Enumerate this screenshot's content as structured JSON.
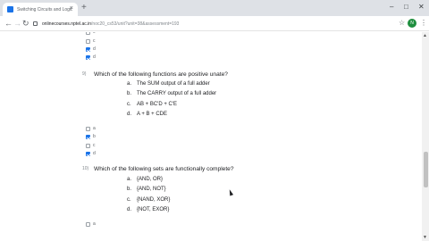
{
  "browser": {
    "tab_title": "Switching Circuits and Logic Des",
    "tab_close": "×",
    "new_tab": "+",
    "url_domain": "onlinecourses.nptel.ac.in",
    "url_rest": "/noc20_cs53/unit?unit=38&assessment=193",
    "avatar_initial": "N",
    "window_controls": {
      "minimize": "–",
      "maximize": "□",
      "close": "✕"
    }
  },
  "questions": [
    {
      "number": "9)",
      "text": "Which of the following functions are positive unate?",
      "choices": [
        {
          "label": "a.",
          "text": "The SUM output of a full adder"
        },
        {
          "label": "b.",
          "text": "The CARRY output of a full adder"
        },
        {
          "label": "c.",
          "text": "AB + BC'D + C'E"
        },
        {
          "label": "d.",
          "text": "A + B + CDE"
        }
      ],
      "answer_options": [
        {
          "letter": "a",
          "checked": false
        },
        {
          "letter": "b",
          "checked": true
        },
        {
          "letter": "c",
          "checked": false
        },
        {
          "letter": "d",
          "checked": true
        }
      ]
    },
    {
      "number": "10)",
      "text": "Which of the following sets are functionally complete?",
      "choices": [
        {
          "label": "a.",
          "text": "{AND, OR}"
        },
        {
          "label": "b.",
          "text": "{AND, NOT}"
        },
        {
          "label": "c.",
          "text": "{NAND, XOR}"
        },
        {
          "label": "d.",
          "text": "{NOT, EXOR}"
        }
      ],
      "answer_options": [
        {
          "letter": "a",
          "checked": false
        }
      ]
    }
  ],
  "previous_answer_options": [
    {
      "letter": "c",
      "checked": false
    },
    {
      "letter": "d",
      "checked": true
    }
  ]
}
